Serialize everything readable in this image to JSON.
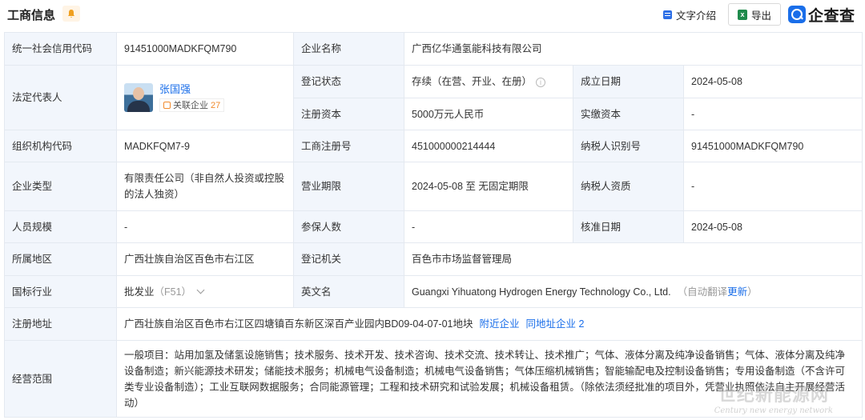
{
  "header": {
    "title": "工商信息",
    "text_intro": "文字介绍",
    "export": "导出",
    "brand": "企查查"
  },
  "rows": {
    "credit_code_label": "统一社会信用代码",
    "credit_code": "91451000MADKFQM790",
    "company_name_label": "企业名称",
    "company_name": "广西亿华通氢能科技有限公司",
    "legal_rep_label": "法定代表人",
    "legal_rep_name": "张国强",
    "related_label": "关联企业",
    "related_count": "27",
    "reg_status_label": "登记状态",
    "reg_status": "存续（在营、开业、在册）",
    "founded_label": "成立日期",
    "founded": "2024-05-08",
    "reg_capital_label": "注册资本",
    "reg_capital": "5000万元人民币",
    "paid_capital_label": "实缴资本",
    "paid_capital": "-",
    "org_code_label": "组织机构代码",
    "org_code": "MADKFQM7-9",
    "biz_reg_no_label": "工商注册号",
    "biz_reg_no": "451000000214444",
    "taxpayer_id_label": "纳税人识别号",
    "taxpayer_id": "91451000MADKFQM790",
    "company_type_label": "企业类型",
    "company_type": "有限责任公司（非自然人投资或控股的法人独资）",
    "term_label": "营业期限",
    "term": "2024-05-08 至 无固定期限",
    "taxpayer_qual_label": "纳税人资质",
    "taxpayer_qual": "-",
    "staff_size_label": "人员规模",
    "staff_size": "-",
    "insured_label": "参保人数",
    "insured": "-",
    "approval_date_label": "核准日期",
    "approval_date": "2024-05-08",
    "region_label": "所属地区",
    "region": "广西壮族自治区百色市右江区",
    "reg_authority_label": "登记机关",
    "reg_authority": "百色市市场监督管理局",
    "industry_label": "国标行业",
    "industry": "批发业",
    "industry_code": "（F51）",
    "english_name_label": "英文名",
    "english_name": "Guangxi Yihuatong Hydrogen Energy Technology Co., Ltd.",
    "auto_translate": "（自动翻译",
    "update_link": "更新",
    "auto_translate_close": "）",
    "address_label": "注册地址",
    "address": "广西壮族自治区百色市右江区四塘镇百东新区深百产业园内BD09-04-07-01地块",
    "nearby_link": "附近企业",
    "same_address_link": "同地址企业 2",
    "scope_label": "经营范围",
    "scope": "一般项目：站用加氢及储氢设施销售；技术服务、技术开发、技术咨询、技术交流、技术转让、技术推广；气体、液体分离及纯净设备销售；气体、液体分离及纯净设备制造；新兴能源技术研发；储能技术服务；机械电气设备制造；机械电气设备销售；气体压缩机械销售；智能输配电及控制设备销售；专用设备制造（不含许可类专业设备制造）；工业互联网数据服务；合同能源管理；工程和技术研究和试验发展；机械设备租赁。（除依法须经批准的项目外，凭营业执照依法自主开展经营活动）"
  },
  "watermark": {
    "cn": "世纪新能源网",
    "en": "Century new energy network"
  }
}
